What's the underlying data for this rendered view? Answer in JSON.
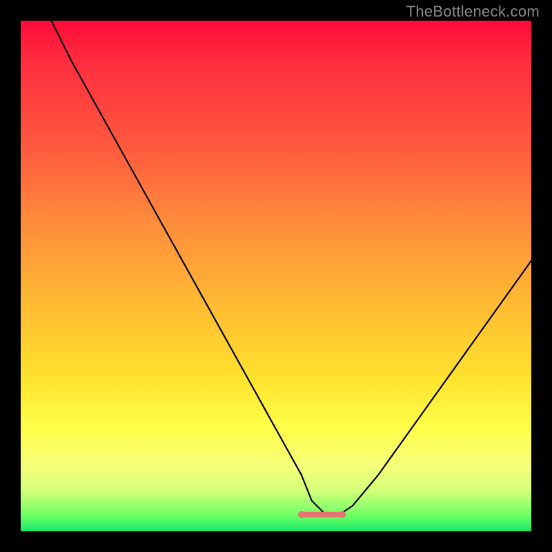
{
  "watermark": "TheBottleneck.com",
  "colors": {
    "frame": "#000000",
    "gradient_stops": [
      "#ff0b3a",
      "#ff2d3f",
      "#ff5a3e",
      "#ff8d3a",
      "#ffb933",
      "#ffe22d",
      "#ffff4a",
      "#f6ff78",
      "#d4ff7a",
      "#6cff64",
      "#16e86a"
    ],
    "curve": "#000000",
    "bottom_marker": "#e57373"
  },
  "chart_data": {
    "type": "line",
    "title": "",
    "xlabel": "",
    "ylabel": "",
    "xlim": [
      0,
      100
    ],
    "ylim": [
      0,
      100
    ],
    "series": [
      {
        "name": "bottleneck-curve",
        "x": [
          6,
          10,
          15,
          20,
          25,
          30,
          35,
          40,
          45,
          50,
          55,
          57,
          60,
          62,
          65,
          70,
          75,
          80,
          85,
          90,
          95,
          100
        ],
        "values": [
          100,
          92,
          83,
          74,
          65,
          56,
          47,
          38,
          29,
          20,
          11,
          6,
          3,
          3,
          5,
          11,
          18,
          25,
          32,
          39,
          46,
          53
        ]
      }
    ],
    "annotations": [
      {
        "name": "flat-bottom-marker",
        "x_range": [
          55,
          63
        ],
        "y": 3
      }
    ]
  }
}
